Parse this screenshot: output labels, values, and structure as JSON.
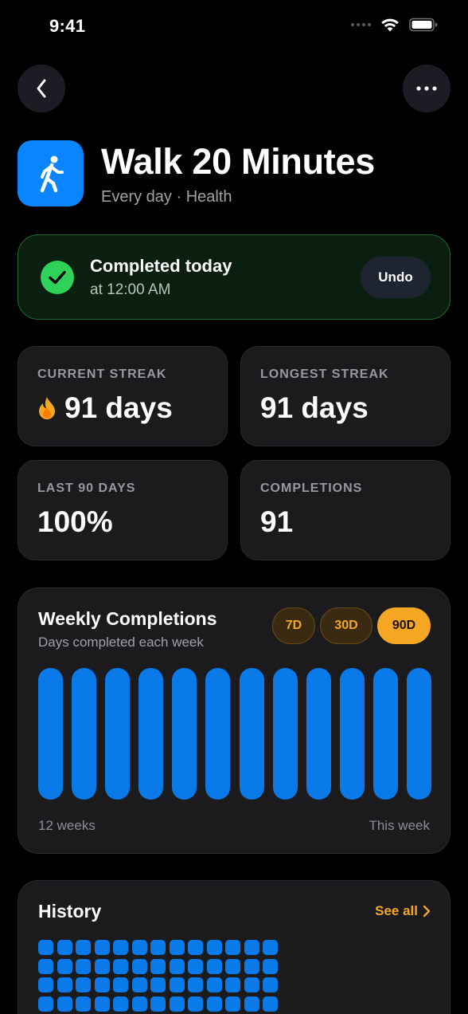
{
  "status_bar": {
    "time": "9:41"
  },
  "habit": {
    "title": "Walk 20 Minutes",
    "subtitle": "Every day · Health",
    "icon": "walking-figure-icon",
    "accent": "#0a84ff"
  },
  "completion": {
    "title": "Completed today",
    "time": "at 12:00 AM",
    "undo_label": "Undo",
    "status_color": "#30d158"
  },
  "stats": {
    "current_streak": {
      "label": "CURRENT STREAK",
      "value": "91 days",
      "icon": "flame-icon"
    },
    "longest_streak": {
      "label": "LONGEST STREAK",
      "value": "91 days"
    },
    "last_90_days": {
      "label": "LAST 90 DAYS",
      "value": "100%"
    },
    "completions": {
      "label": "COMPLETIONS",
      "value": "91"
    }
  },
  "weekly_chart": {
    "title": "Weekly Completions",
    "subtitle": "Days completed each week",
    "ranges": [
      "7D",
      "30D",
      "90D"
    ],
    "selected_range": "90D",
    "axis_start_label": "12 weeks",
    "axis_end_label": "This week",
    "bar_color": "#0a7ae8"
  },
  "chart_data": {
    "type": "bar",
    "title": "Weekly Completions",
    "subtitle": "Days completed each week",
    "categories": [
      "12 weeks",
      "",
      "",
      "",
      "",
      "",
      "",
      "",
      "",
      "",
      "",
      "This week"
    ],
    "values": [
      7,
      7,
      7,
      7,
      7,
      7,
      7,
      7,
      7,
      7,
      7,
      7
    ],
    "ylim": [
      0,
      7
    ],
    "grid": false
  },
  "history": {
    "title": "History",
    "see_all_label": "See all",
    "visible_cells": 52,
    "cell_color": "#0a7ae8"
  },
  "colors": {
    "background": "#000000",
    "card": "#1b1b1e",
    "accent_orange": "#f5a623"
  }
}
